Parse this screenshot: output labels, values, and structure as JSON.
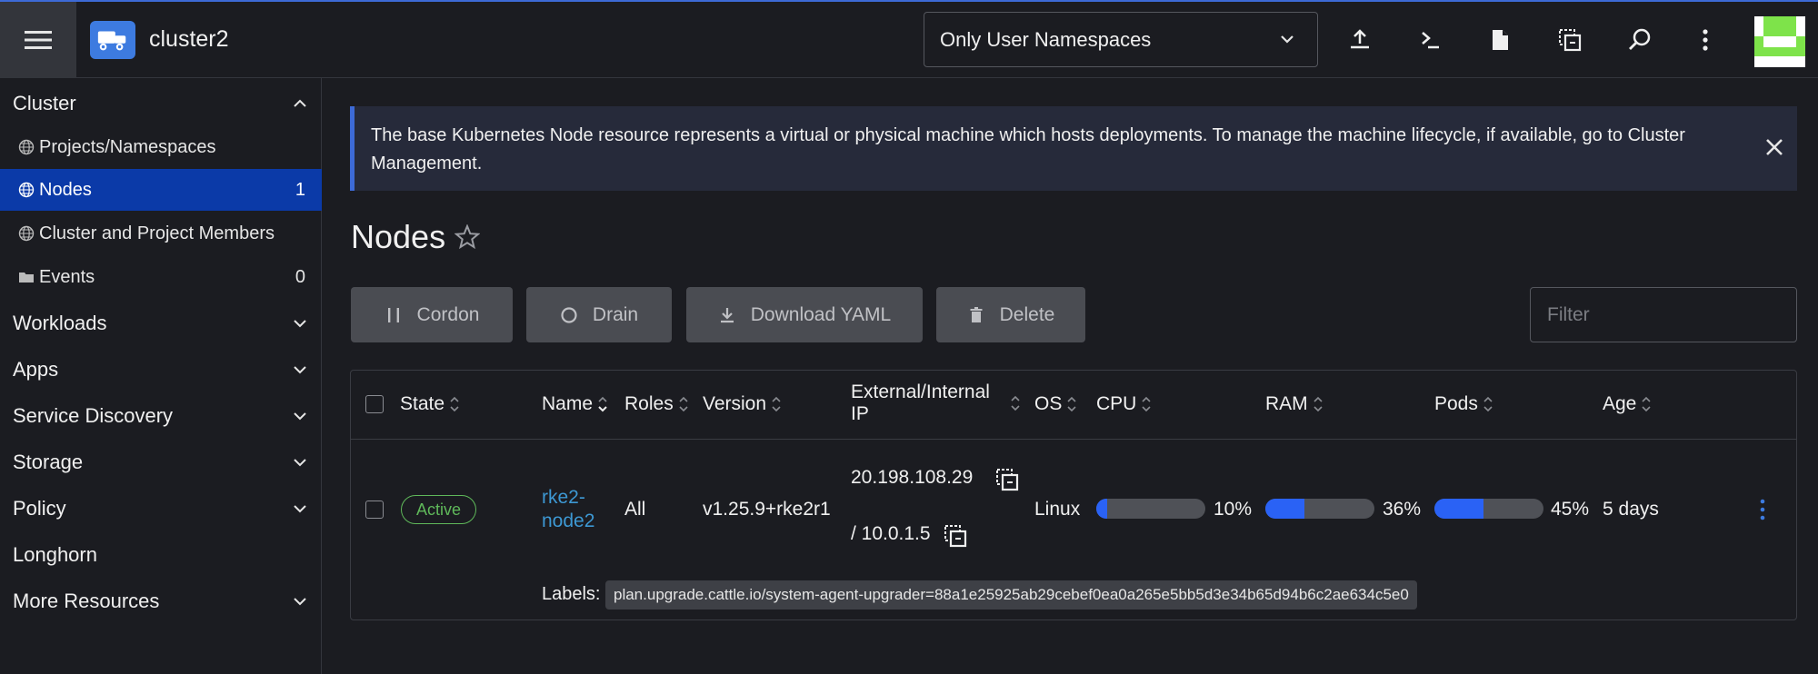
{
  "header": {
    "cluster_name": "cluster2",
    "namespace_filter": "Only User Namespaces",
    "icons": [
      "upload-icon",
      "terminal-icon",
      "file-icon",
      "copy-icon",
      "search-icon",
      "more-vertical-icon"
    ]
  },
  "sidebar": {
    "cluster_group": "Cluster",
    "items": [
      {
        "label": "Projects/Namespaces",
        "icon": "globe-icon",
        "count": ""
      },
      {
        "label": "Nodes",
        "icon": "globe-icon",
        "count": "1"
      },
      {
        "label": "Cluster and Project Members",
        "icon": "globe-icon",
        "count": ""
      },
      {
        "label": "Events",
        "icon": "folder-icon",
        "count": "0"
      }
    ],
    "groups": [
      "Workloads",
      "Apps",
      "Service Discovery",
      "Storage",
      "Policy",
      "Longhorn",
      "More Resources"
    ]
  },
  "banner": {
    "text": "The base Kubernetes Node resource represents a virtual or physical machine which hosts deployments. To manage the machine lifecycle, if available, go to Cluster Management."
  },
  "page": {
    "title": "Nodes"
  },
  "actions": {
    "cordon": "Cordon",
    "drain": "Drain",
    "download_yaml": "Download YAML",
    "delete": "Delete",
    "filter_placeholder": "Filter"
  },
  "table": {
    "columns": {
      "state": "State",
      "name": "Name",
      "roles": "Roles",
      "version": "Version",
      "ip": "External/Internal IP",
      "os": "OS",
      "cpu": "CPU",
      "ram": "RAM",
      "pods": "Pods",
      "age": "Age"
    },
    "row": {
      "state": "Active",
      "name": "rke2-node2",
      "roles": "All",
      "version": "v1.25.9+rke2r1",
      "external_ip": "20.198.108.29",
      "internal_ip": "/ 10.0.1.5",
      "os": "Linux",
      "cpu_label": "10%",
      "cpu_fraction": 0.1,
      "ram_label": "36%",
      "ram_fraction": 0.36,
      "pods_label": "45%",
      "pods_fraction": 0.45,
      "age": "5 days",
      "labels_title": "Labels:",
      "label_value": "plan.upgrade.cattle.io/system-agent-upgrader=88a1e25925ab29cebef0ea0a265e5bb5d3e34b65d94b6c2ae634c5e0"
    }
  },
  "colors": {
    "accent": "#2a62f5",
    "active_nav": "#0b3aa8",
    "status_active": "#5fb85a",
    "link": "#3d98d3",
    "avatar": "#7ee34a"
  }
}
